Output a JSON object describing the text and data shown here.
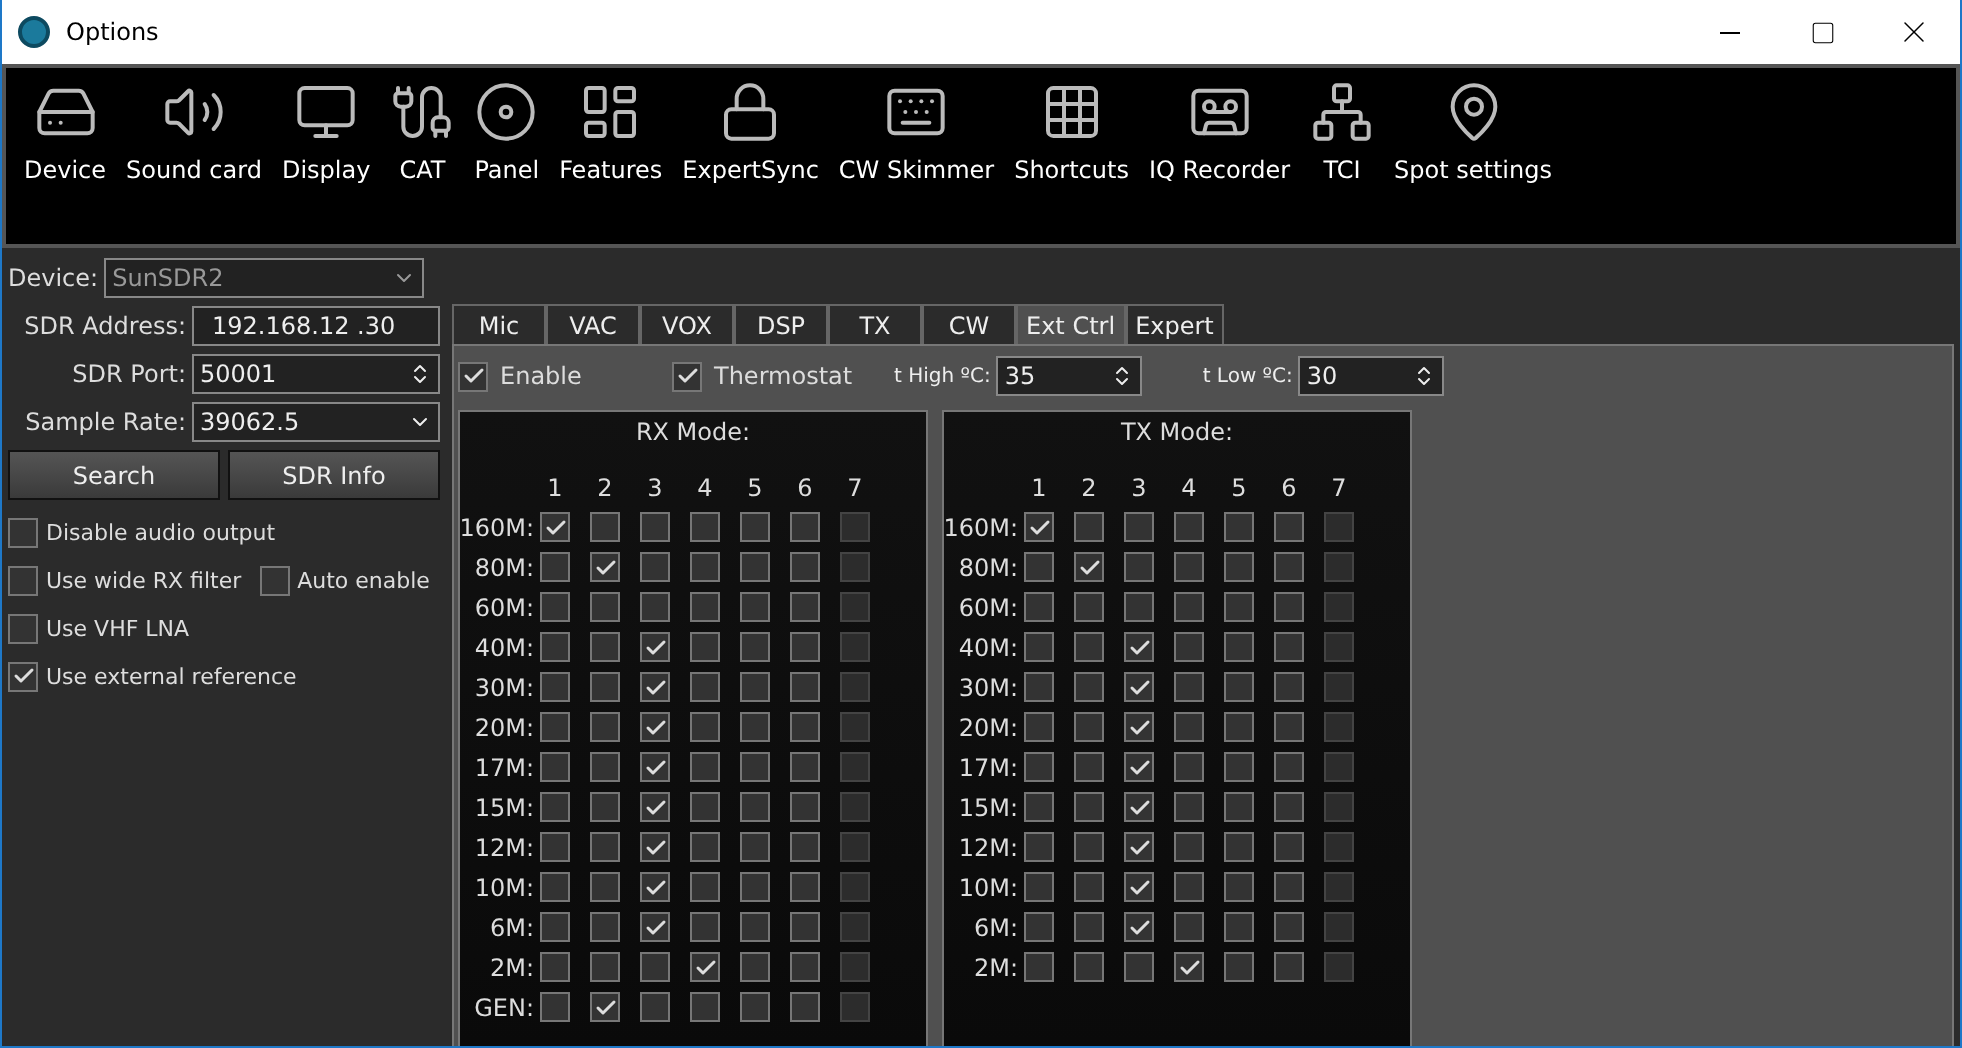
{
  "window": {
    "title": "Options"
  },
  "toolbar": [
    "Device",
    "Sound card",
    "Display",
    "CAT",
    "Panel",
    "Features",
    "ExpertSync",
    "CW Skimmer",
    "Shortcuts",
    "IQ Recorder",
    "TCI",
    "Spot settings"
  ],
  "device": {
    "label": "Device:",
    "value": "SunSDR2"
  },
  "sdr_address": {
    "label": "SDR Address:",
    "value": "192.168.12 .30"
  },
  "sdr_port": {
    "label": "SDR Port:",
    "value": "50001"
  },
  "sample_rate": {
    "label": "Sample Rate:",
    "value": "39062.5"
  },
  "buttons": [
    "Search",
    "SDR Info"
  ],
  "options": [
    {
      "label": "Disable audio output",
      "checked": false
    },
    {
      "label": "Use wide RX filter",
      "checked": false,
      "extra": {
        "label": "Auto enable",
        "checked": false
      }
    },
    {
      "label": "Use VHF LNA",
      "checked": false
    },
    {
      "label": "Use external reference",
      "checked": true
    }
  ],
  "tabs": [
    {
      "label": "Mic",
      "selected": false
    },
    {
      "label": "VAC",
      "selected": false
    },
    {
      "label": "VOX",
      "selected": false
    },
    {
      "label": "DSP",
      "selected": false
    },
    {
      "label": "TX",
      "selected": false
    },
    {
      "label": "CW",
      "selected": false
    },
    {
      "label": "Ext Ctrl",
      "selected": true
    },
    {
      "label": "Expert",
      "selected": false
    }
  ],
  "ext_ctrl": {
    "enable": {
      "label": "Enable",
      "checked": true
    },
    "thermostat": {
      "label": "Thermostat",
      "checked": true
    },
    "t_high": {
      "label": "t High ºC:",
      "value": "35"
    },
    "t_low": {
      "label": "t Low ºC:",
      "value": "30"
    },
    "grids": [
      {
        "title": "RX Mode:",
        "columns": [
          {
            "label": "1",
            "disabled": false
          },
          {
            "label": "2",
            "disabled": false
          },
          {
            "label": "3",
            "disabled": false
          },
          {
            "label": "4",
            "disabled": false
          },
          {
            "label": "5",
            "disabled": false
          },
          {
            "label": "6",
            "disabled": false
          },
          {
            "label": "7",
            "disabled": true
          }
        ],
        "rows": [
          {
            "band": "160M:",
            "checks": [
              true,
              false,
              false,
              false,
              false,
              false,
              false
            ]
          },
          {
            "band": "80M:",
            "checks": [
              false,
              true,
              false,
              false,
              false,
              false,
              false
            ]
          },
          {
            "band": "60M:",
            "checks": [
              false,
              false,
              false,
              false,
              false,
              false,
              false
            ]
          },
          {
            "band": "40M:",
            "checks": [
              false,
              false,
              true,
              false,
              false,
              false,
              false
            ]
          },
          {
            "band": "30M:",
            "checks": [
              false,
              false,
              true,
              false,
              false,
              false,
              false
            ]
          },
          {
            "band": "20M:",
            "checks": [
              false,
              false,
              true,
              false,
              false,
              false,
              false
            ]
          },
          {
            "band": "17M:",
            "checks": [
              false,
              false,
              true,
              false,
              false,
              false,
              false
            ]
          },
          {
            "band": "15M:",
            "checks": [
              false,
              false,
              true,
              false,
              false,
              false,
              false
            ]
          },
          {
            "band": "12M:",
            "checks": [
              false,
              false,
              true,
              false,
              false,
              false,
              false
            ]
          },
          {
            "band": "10M:",
            "checks": [
              false,
              false,
              true,
              false,
              false,
              false,
              false
            ]
          },
          {
            "band": "6M:",
            "checks": [
              false,
              false,
              true,
              false,
              false,
              false,
              false
            ]
          },
          {
            "band": "2M:",
            "checks": [
              false,
              false,
              false,
              true,
              false,
              false,
              false
            ]
          },
          {
            "band": "GEN:",
            "checks": [
              false,
              true,
              false,
              false,
              false,
              false,
              false
            ]
          }
        ]
      },
      {
        "title": "TX Mode:",
        "columns": [
          {
            "label": "1",
            "disabled": false
          },
          {
            "label": "2",
            "disabled": false
          },
          {
            "label": "3",
            "disabled": false
          },
          {
            "label": "4",
            "disabled": false
          },
          {
            "label": "5",
            "disabled": false
          },
          {
            "label": "6",
            "disabled": false
          },
          {
            "label": "7",
            "disabled": true
          }
        ],
        "rows": [
          {
            "band": "160M:",
            "checks": [
              true,
              false,
              false,
              false,
              false,
              false,
              false
            ]
          },
          {
            "band": "80M:",
            "checks": [
              false,
              true,
              false,
              false,
              false,
              false,
              false
            ]
          },
          {
            "band": "60M:",
            "checks": [
              false,
              false,
              false,
              false,
              false,
              false,
              false
            ]
          },
          {
            "band": "40M:",
            "checks": [
              false,
              false,
              true,
              false,
              false,
              false,
              false
            ]
          },
          {
            "band": "30M:",
            "checks": [
              false,
              false,
              true,
              false,
              false,
              false,
              false
            ]
          },
          {
            "band": "20M:",
            "checks": [
              false,
              false,
              true,
              false,
              false,
              false,
              false
            ]
          },
          {
            "band": "17M:",
            "checks": [
              false,
              false,
              true,
              false,
              false,
              false,
              false
            ]
          },
          {
            "band": "15M:",
            "checks": [
              false,
              false,
              true,
              false,
              false,
              false,
              false
            ]
          },
          {
            "band": "12M:",
            "checks": [
              false,
              false,
              true,
              false,
              false,
              false,
              false
            ]
          },
          {
            "band": "10M:",
            "checks": [
              false,
              false,
              true,
              false,
              false,
              false,
              false
            ]
          },
          {
            "band": "6M:",
            "checks": [
              false,
              false,
              true,
              false,
              false,
              false,
              false
            ]
          },
          {
            "band": "2M:",
            "checks": [
              false,
              false,
              false,
              true,
              false,
              false,
              false
            ]
          }
        ]
      }
    ]
  }
}
